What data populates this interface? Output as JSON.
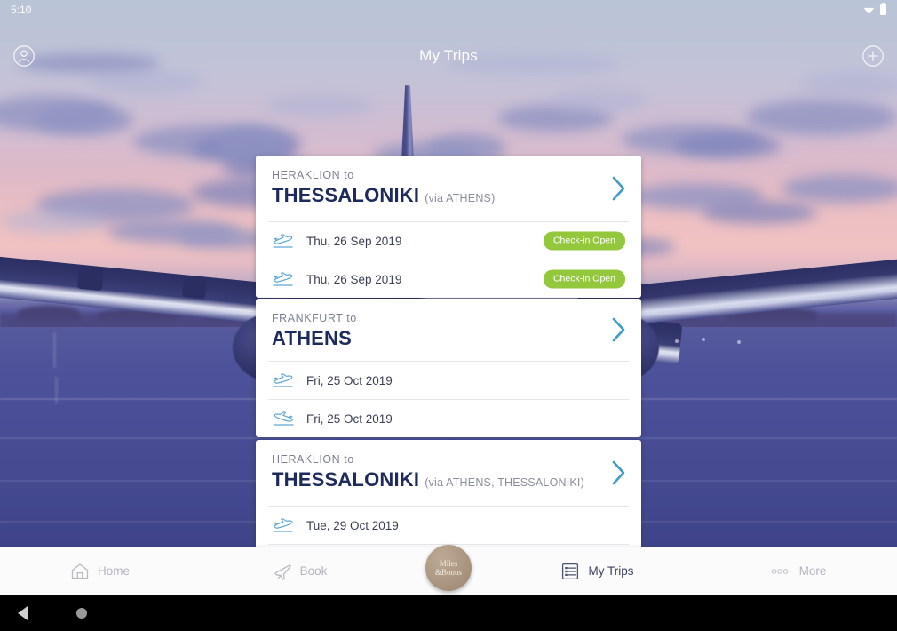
{
  "status_bar": {
    "time": "5:10",
    "wifi_icon": "wifi-icon",
    "battery_icon": "battery-icon"
  },
  "top_bar": {
    "title": "My Trips",
    "account_icon": "account-circle-icon",
    "add_icon": "add-circle-icon"
  },
  "trips": [
    {
      "from_label": "HERAKLION to",
      "to_label": "THESSALONIKI",
      "via_label": "(via ATHENS)",
      "chevron_icon": "chevron-right-icon",
      "flights": [
        {
          "plane_icon": "plane-departure-icon",
          "date": "Thu, 26 Sep 2019",
          "badge": "Check-in Open",
          "direction": "outbound"
        },
        {
          "plane_icon": "plane-departure-icon",
          "date": "Thu, 26 Sep 2019",
          "badge": "Check-in Open",
          "direction": "outbound"
        }
      ]
    },
    {
      "from_label": "FRANKFURT to",
      "to_label": "ATHENS",
      "via_label": "",
      "chevron_icon": "chevron-right-icon",
      "flights": [
        {
          "plane_icon": "plane-departure-icon",
          "date": "Fri, 25 Oct 2019",
          "badge": "",
          "direction": "outbound"
        },
        {
          "plane_icon": "plane-departure-icon",
          "date": "Fri, 25 Oct 2019",
          "badge": "",
          "direction": "return"
        }
      ]
    },
    {
      "from_label": "HERAKLION to",
      "to_label": "THESSALONIKI",
      "via_label": "(via ATHENS, THESSALONIKI)",
      "chevron_icon": "chevron-right-icon",
      "flights": [
        {
          "plane_icon": "plane-departure-icon",
          "date": "Tue, 29 Oct 2019",
          "badge": "",
          "direction": "outbound"
        }
      ]
    }
  ],
  "tab_bar": {
    "items": [
      {
        "label": "Home",
        "icon": "home-icon",
        "active": false
      },
      {
        "label": "Book",
        "icon": "airplane-icon",
        "active": false
      },
      {
        "label": "My Trips",
        "icon": "list-icon",
        "active": true
      },
      {
        "label": "More",
        "icon": "more-dots-icon",
        "active": false
      }
    ],
    "center_button": {
      "line1": "Miles",
      "line2": "&Bonus",
      "icon": "miles-bonus-badge"
    }
  },
  "system_nav": {
    "back_icon": "back-triangle-icon",
    "home_icon": "home-circle-icon"
  },
  "colors": {
    "badge_green": "#93c83d",
    "title_navy": "#1d2b5c",
    "chevron_blue": "#3d9cc9",
    "miles_tan": "#ab9781",
    "tab_active": "#3d4463"
  }
}
